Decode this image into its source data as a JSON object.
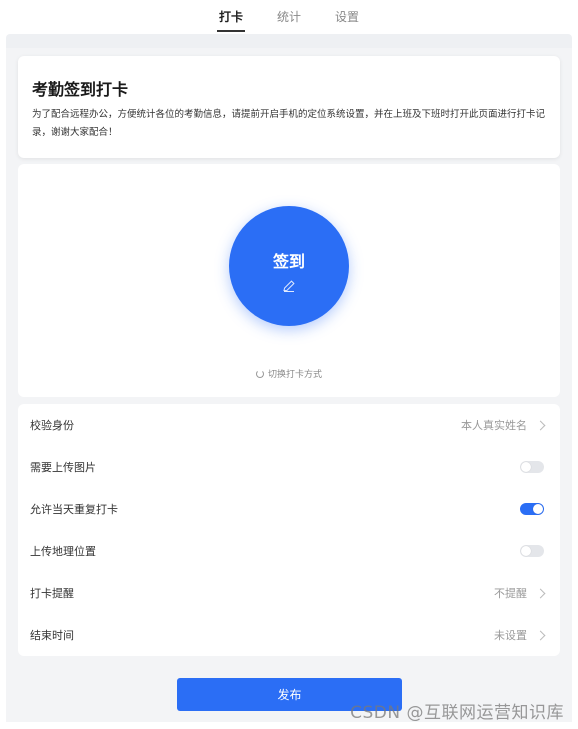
{
  "tabs": [
    {
      "label": "打卡",
      "active": true
    },
    {
      "label": "统计",
      "active": false
    },
    {
      "label": "设置",
      "active": false
    }
  ],
  "intro": {
    "title": "考勤签到打卡",
    "description": "为了配合远程办公，方便统计各位的考勤信息，请提前开启手机的定位系统设置，并在上班及下班时打开此页面进行打卡记录，谢谢大家配合！"
  },
  "sign": {
    "button_label": "签到",
    "edit_icon": "pencil-icon",
    "switch_mode_label": "切换打卡方式",
    "switch_icon": "refresh-icon"
  },
  "settings": [
    {
      "label": "校验身份",
      "value": "本人真实姓名",
      "type": "link"
    },
    {
      "label": "需要上传图片",
      "type": "toggle",
      "on": false
    },
    {
      "label": "允许当天重复打卡",
      "type": "toggle",
      "on": true
    },
    {
      "label": "上传地理位置",
      "type": "toggle",
      "on": false
    },
    {
      "label": "打卡提醒",
      "value": "不提醒",
      "type": "link"
    },
    {
      "label": "结束时间",
      "value": "未设置",
      "type": "link"
    }
  ],
  "publish_label": "发布",
  "watermark": "CSDN @互联网运营知识库",
  "colors": {
    "accent": "#2b6ef5",
    "background": "#eef0f3"
  }
}
